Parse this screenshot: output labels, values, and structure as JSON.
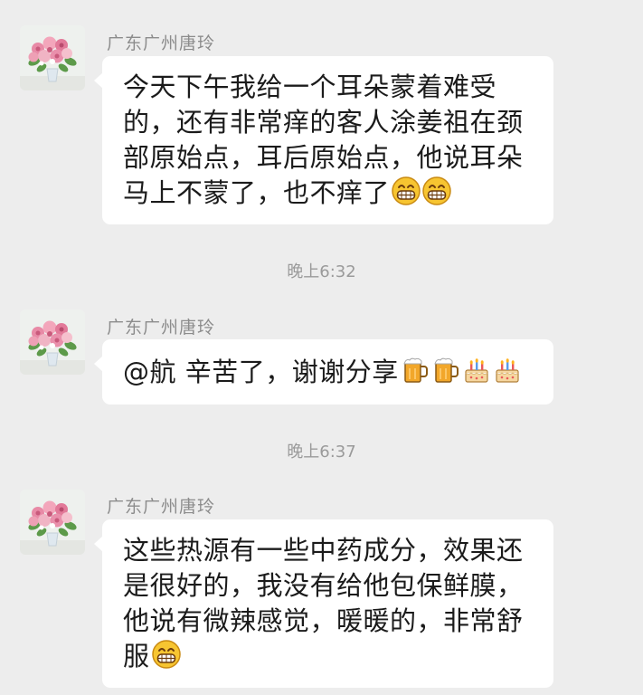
{
  "messages": [
    {
      "sender": "广东广州唐玲",
      "lines": [
        "今天下午我给一个耳朵蒙着难受",
        "的，还有非常痒的客人涂姜祖在颈",
        "部原始点，耳后原始点，他说耳朵",
        "马上不蒙了，也不痒了"
      ],
      "emoji": [
        "grin-icon",
        "grin-icon"
      ]
    },
    {
      "sender": "广东广州唐玲",
      "lines": [
        "@航  辛苦了，谢谢分享"
      ],
      "emoji": [
        "beer-icon",
        "beer-icon",
        "cake-icon",
        "cake-icon"
      ]
    },
    {
      "sender": "广东广州唐玲",
      "lines": [
        "这些热源有一些中药成分，效果还",
        "是很好的，我没有给他包保鲜膜，",
        "他说有微辣感觉，暖暖的，非常舒",
        "服"
      ],
      "emoji": [
        "grin-icon"
      ]
    }
  ],
  "timestamps": [
    "晚上6:32",
    "晚上6:37"
  ],
  "colors": {
    "background": "#ededed",
    "bubble": "#ffffff",
    "sender_text": "#8c8c8c",
    "timestamp_text": "#9a9a9a"
  }
}
